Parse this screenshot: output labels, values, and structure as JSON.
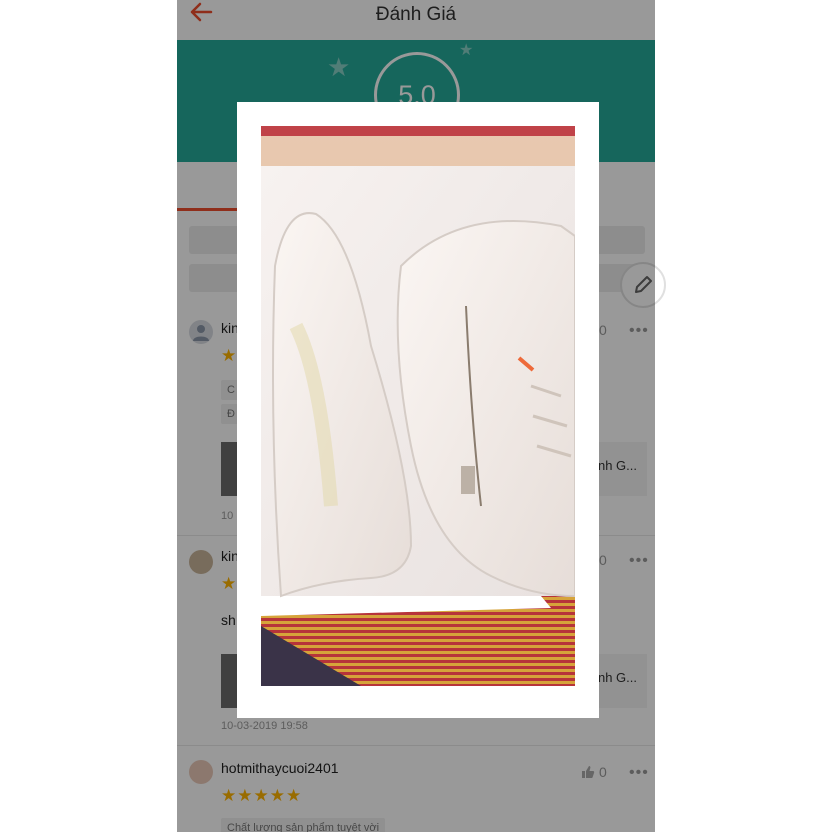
{
  "header": {
    "title": "Đánh Giá",
    "back_icon": "arrow-left-icon"
  },
  "summary": {
    "rating": "5.0",
    "accent_color": "#26aa99",
    "brand_color": "#ee4d2d"
  },
  "reviews": [
    {
      "username": "kin",
      "stars": "★★★★★",
      "likes": "0",
      "product_name": "nh G...",
      "date": "10",
      "tags": [
        "C",
        "Đ"
      ]
    },
    {
      "username": "kin",
      "stars": "★",
      "likes": "0",
      "comment": "sh",
      "product_name": "nh G...",
      "date": "10-03-2019 19:58"
    },
    {
      "username": "hotmithaycuoi2401",
      "stars": "★★★★★",
      "likes": "0",
      "comment": "Chất lượng sản phẩm tuyệt vời"
    }
  ],
  "more_label": "•••",
  "photo_viewer": {
    "subject": "sneaker-photo"
  }
}
